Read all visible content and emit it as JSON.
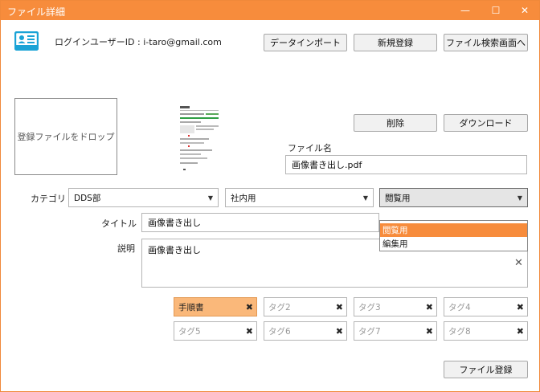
{
  "window": {
    "title": "ファイル詳細",
    "controls": {
      "minimize": "—",
      "maximize": "☐",
      "close": "✕"
    }
  },
  "header": {
    "user_label": "ログインユーザーID : i-taro@gmail.com",
    "buttons": {
      "import": "データインポート",
      "new": "新規登録",
      "search": "ファイル検索画面へ"
    }
  },
  "file": {
    "drop_label": "登録ファイルをドロップ",
    "delete": "削除",
    "download": "ダウンロード",
    "name_label": "ファイル名",
    "name_value": "画像書き出し.pdf"
  },
  "form": {
    "category_label": "カテゴリ",
    "category1": "DDS部",
    "category2": "社内用",
    "category3": "閲覧用",
    "category3_options": [
      "閲覧用",
      "編集用"
    ],
    "title_label": "タイトル",
    "title_value": "画像書き出し",
    "desc_label": "説明",
    "desc_value": "画像書き出し",
    "clear_icon": "✕"
  },
  "tags": [
    {
      "value": "手順書",
      "placeholder": ""
    },
    {
      "value": "",
      "placeholder": "タグ2"
    },
    {
      "value": "",
      "placeholder": "タグ3"
    },
    {
      "value": "",
      "placeholder": "タグ4"
    },
    {
      "value": "",
      "placeholder": "タグ5"
    },
    {
      "value": "",
      "placeholder": "タグ6"
    },
    {
      "value": "",
      "placeholder": "タグ7"
    },
    {
      "value": "",
      "placeholder": "タグ8"
    }
  ],
  "tag_remove": "✖",
  "footer": {
    "register": "ファイル登録"
  },
  "colors": {
    "accent": "#f78c3c",
    "tag_active": "#fab87a",
    "icon_blue": "#1aa3d6"
  }
}
